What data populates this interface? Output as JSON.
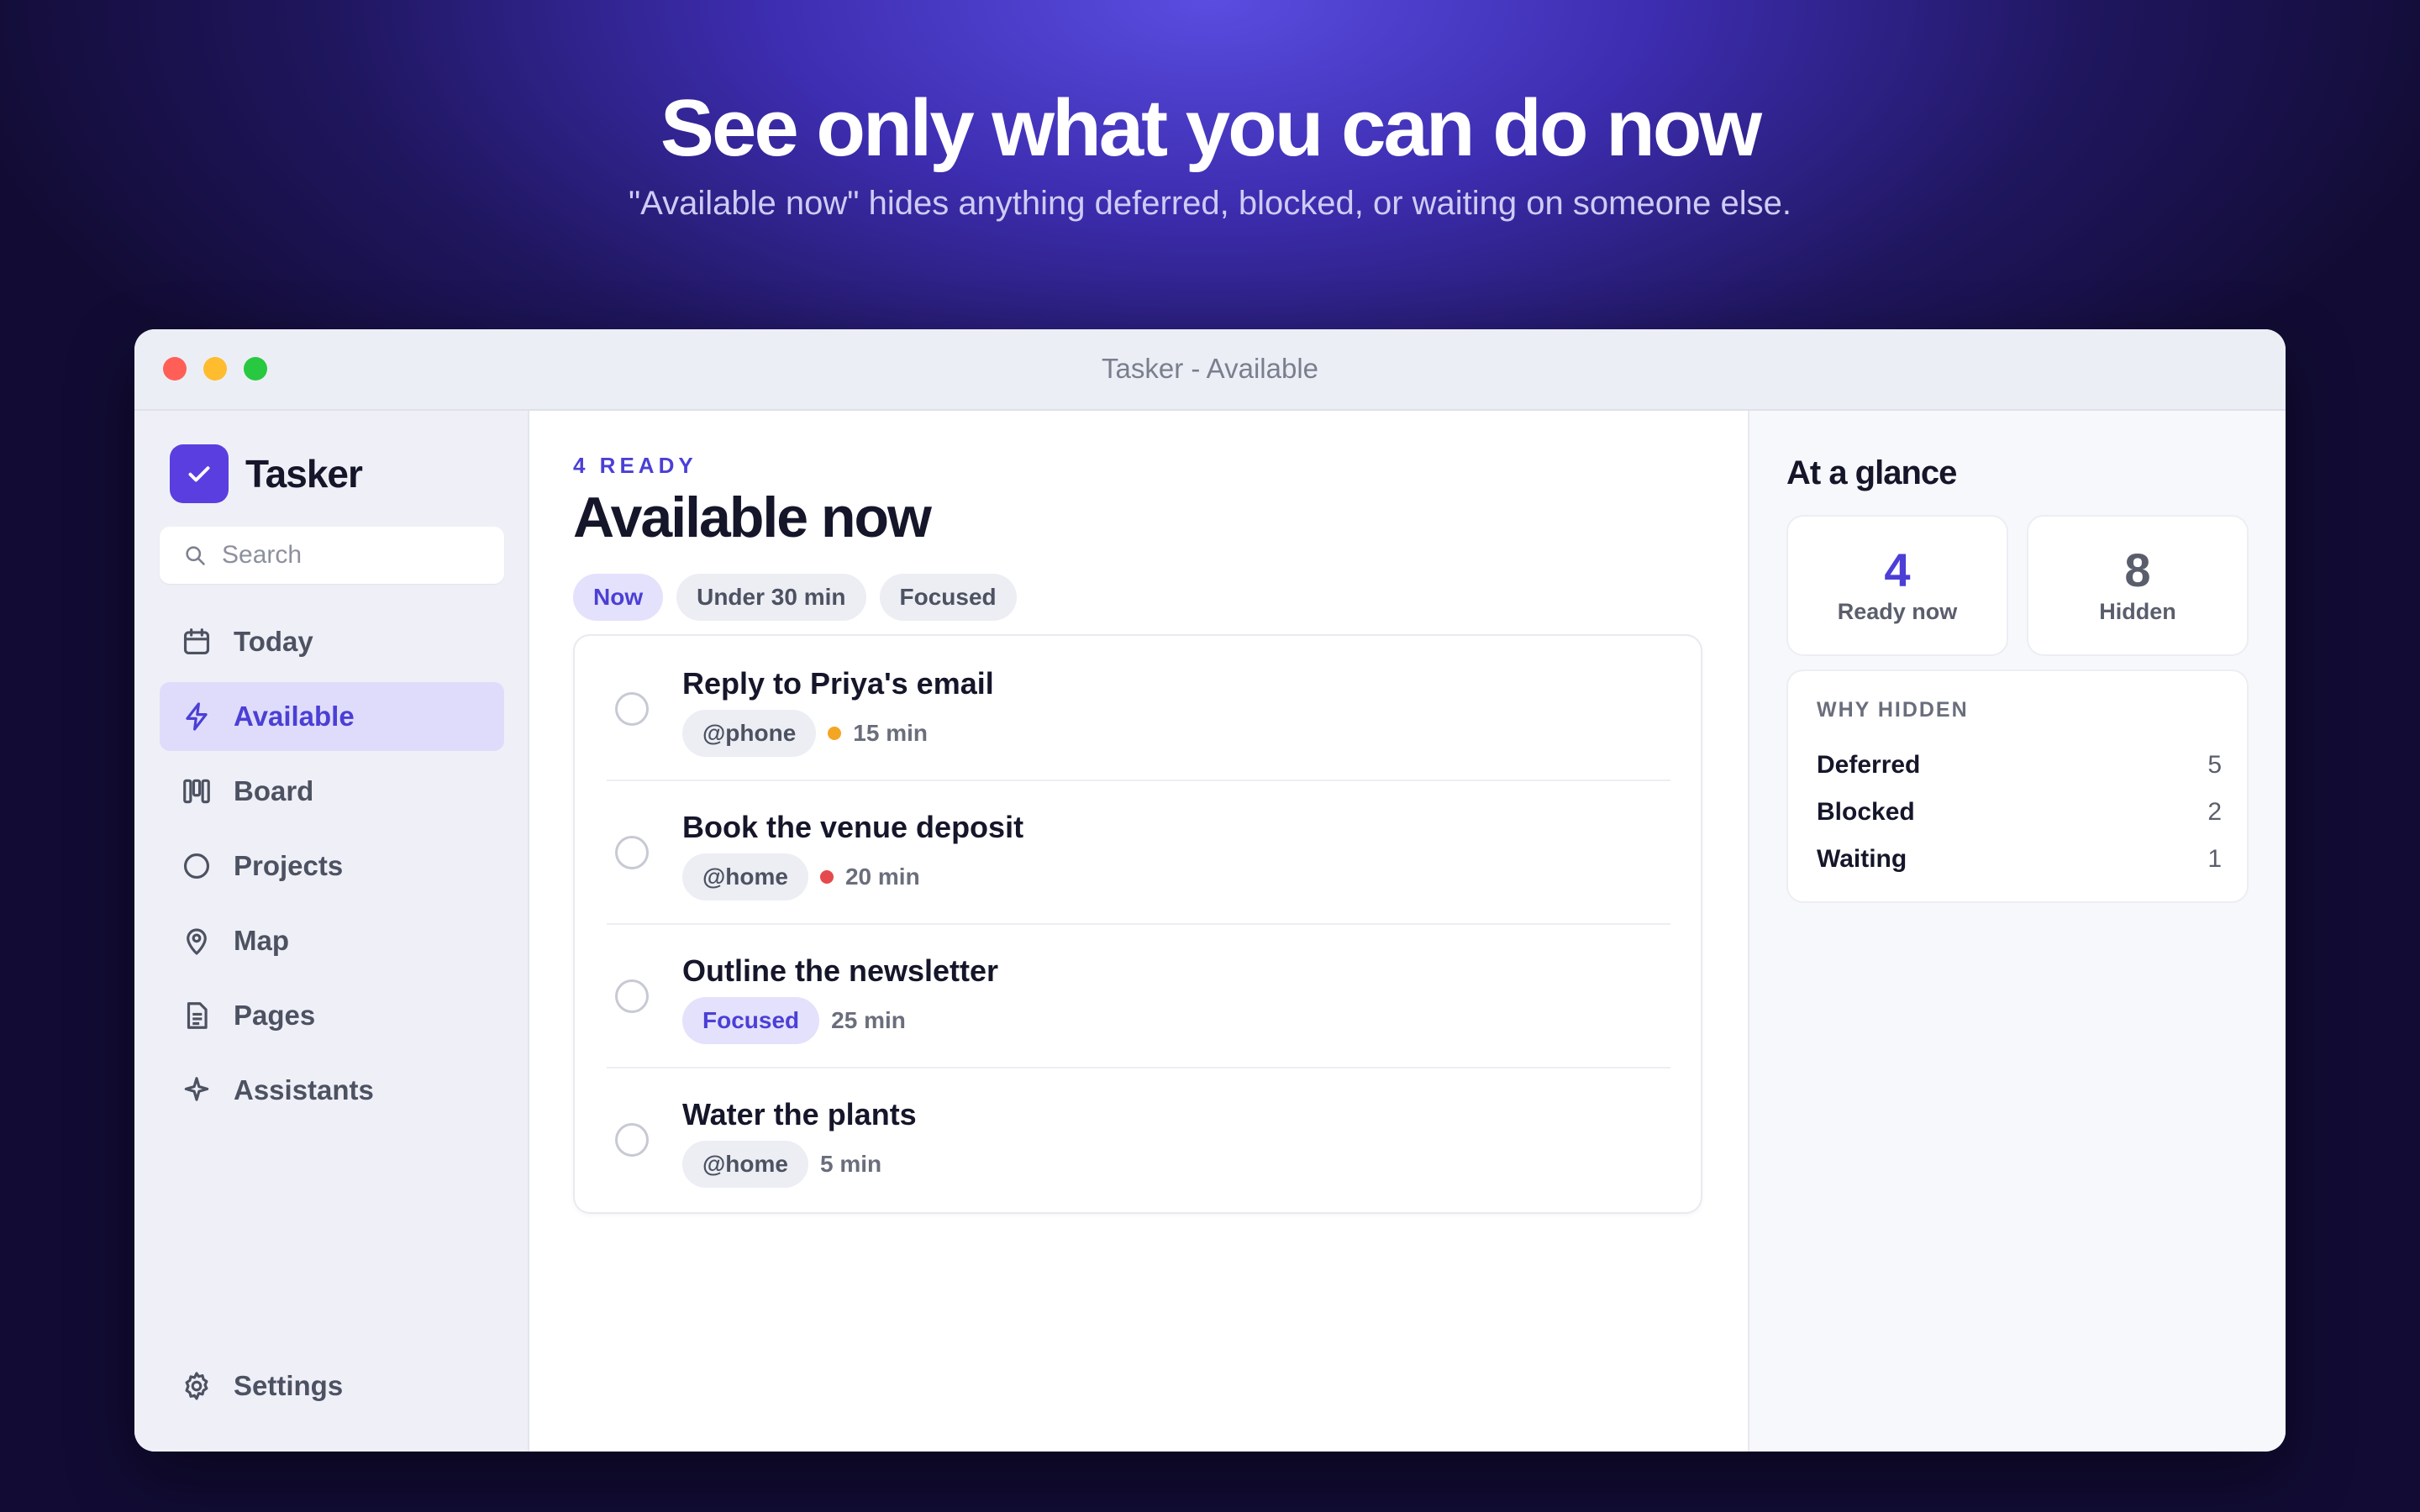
{
  "hero": {
    "title": "See only what you can do now",
    "subtitle": "\"Available now\" hides anything deferred, blocked, or waiting on someone else."
  },
  "window": {
    "title": "Tasker - Available"
  },
  "sidebar": {
    "brand": "Tasker",
    "search_placeholder": "Search",
    "items": [
      {
        "label": "Today",
        "icon": "calendar-icon",
        "active": false
      },
      {
        "label": "Available",
        "icon": "lightning-icon",
        "active": true
      },
      {
        "label": "Board",
        "icon": "board-icon",
        "active": false
      },
      {
        "label": "Projects",
        "icon": "circle-icon",
        "active": false
      },
      {
        "label": "Map",
        "icon": "map-pin-icon",
        "active": false
      },
      {
        "label": "Pages",
        "icon": "document-icon",
        "active": false
      },
      {
        "label": "Assistants",
        "icon": "sparkle-icon",
        "active": false
      }
    ],
    "settings": "Settings"
  },
  "main": {
    "ready_label": "4 READY",
    "title": "Available now",
    "filters": [
      {
        "label": "Now",
        "active": true
      },
      {
        "label": "Under 30 min",
        "active": false
      },
      {
        "label": "Focused",
        "active": false
      }
    ],
    "tasks": [
      {
        "title": "Reply to Priya's email",
        "tag": "@phone",
        "priority_color": "#f5a524",
        "duration": "15 min"
      },
      {
        "title": "Book the venue deposit",
        "tag": "@home",
        "priority_color": "#e5484d",
        "duration": "20 min"
      },
      {
        "title": "Outline the newsletter",
        "tag": "Focused",
        "duration": "25 min"
      },
      {
        "title": "Water the plants",
        "tag": "@home",
        "duration": "5 min"
      }
    ]
  },
  "glance": {
    "title": "At a glance",
    "ready_value": "4",
    "ready_label": "Ready now",
    "hidden_value": "8",
    "hidden_label": "Hidden",
    "why_title": "WHY HIDDEN",
    "reasons": [
      {
        "label": "Deferred",
        "count": "5"
      },
      {
        "label": "Blocked",
        "count": "2"
      },
      {
        "label": "Waiting",
        "count": "1"
      }
    ]
  },
  "colors": {
    "accent": "#4b3fd6",
    "logo": "#5b3ee0",
    "active_bg": "#dfdcfb",
    "priority_medium": "#f5a524",
    "priority_high": "#e5484d"
  }
}
